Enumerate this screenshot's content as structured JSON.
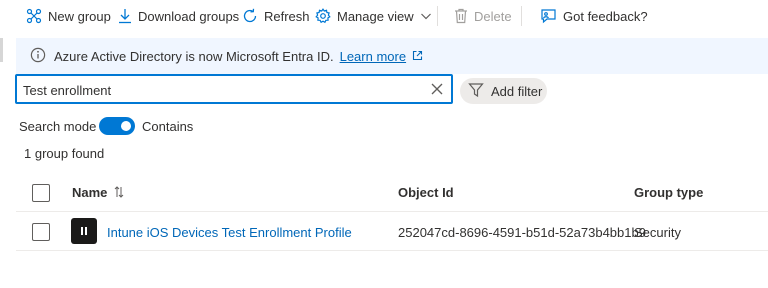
{
  "toolbar": {
    "new_group": "New group",
    "download_groups": "Download groups",
    "refresh": "Refresh",
    "manage_view": "Manage view",
    "delete": "Delete",
    "feedback": "Got feedback?"
  },
  "banner": {
    "message": "Azure Active Directory is now Microsoft Entra ID.",
    "link": "Learn more"
  },
  "search": {
    "value": "Test enrollment"
  },
  "add_filter": "Add filter",
  "search_mode": {
    "label": "Search mode",
    "value": "Contains",
    "enabled": true
  },
  "result_count": "1 group found",
  "table": {
    "headers": {
      "name": "Name",
      "object_id": "Object Id",
      "group_type": "Group type"
    },
    "rows": [
      {
        "name": "Intune iOS Devices Test Enrollment Profile",
        "object_id": "252047cd-8696-4591-b51d-52a73b4bb1b9",
        "group_type": "Security"
      }
    ]
  },
  "colors": {
    "accent": "#0078d4",
    "link": "#0067b8",
    "banner_bg": "#f0f6ff"
  }
}
